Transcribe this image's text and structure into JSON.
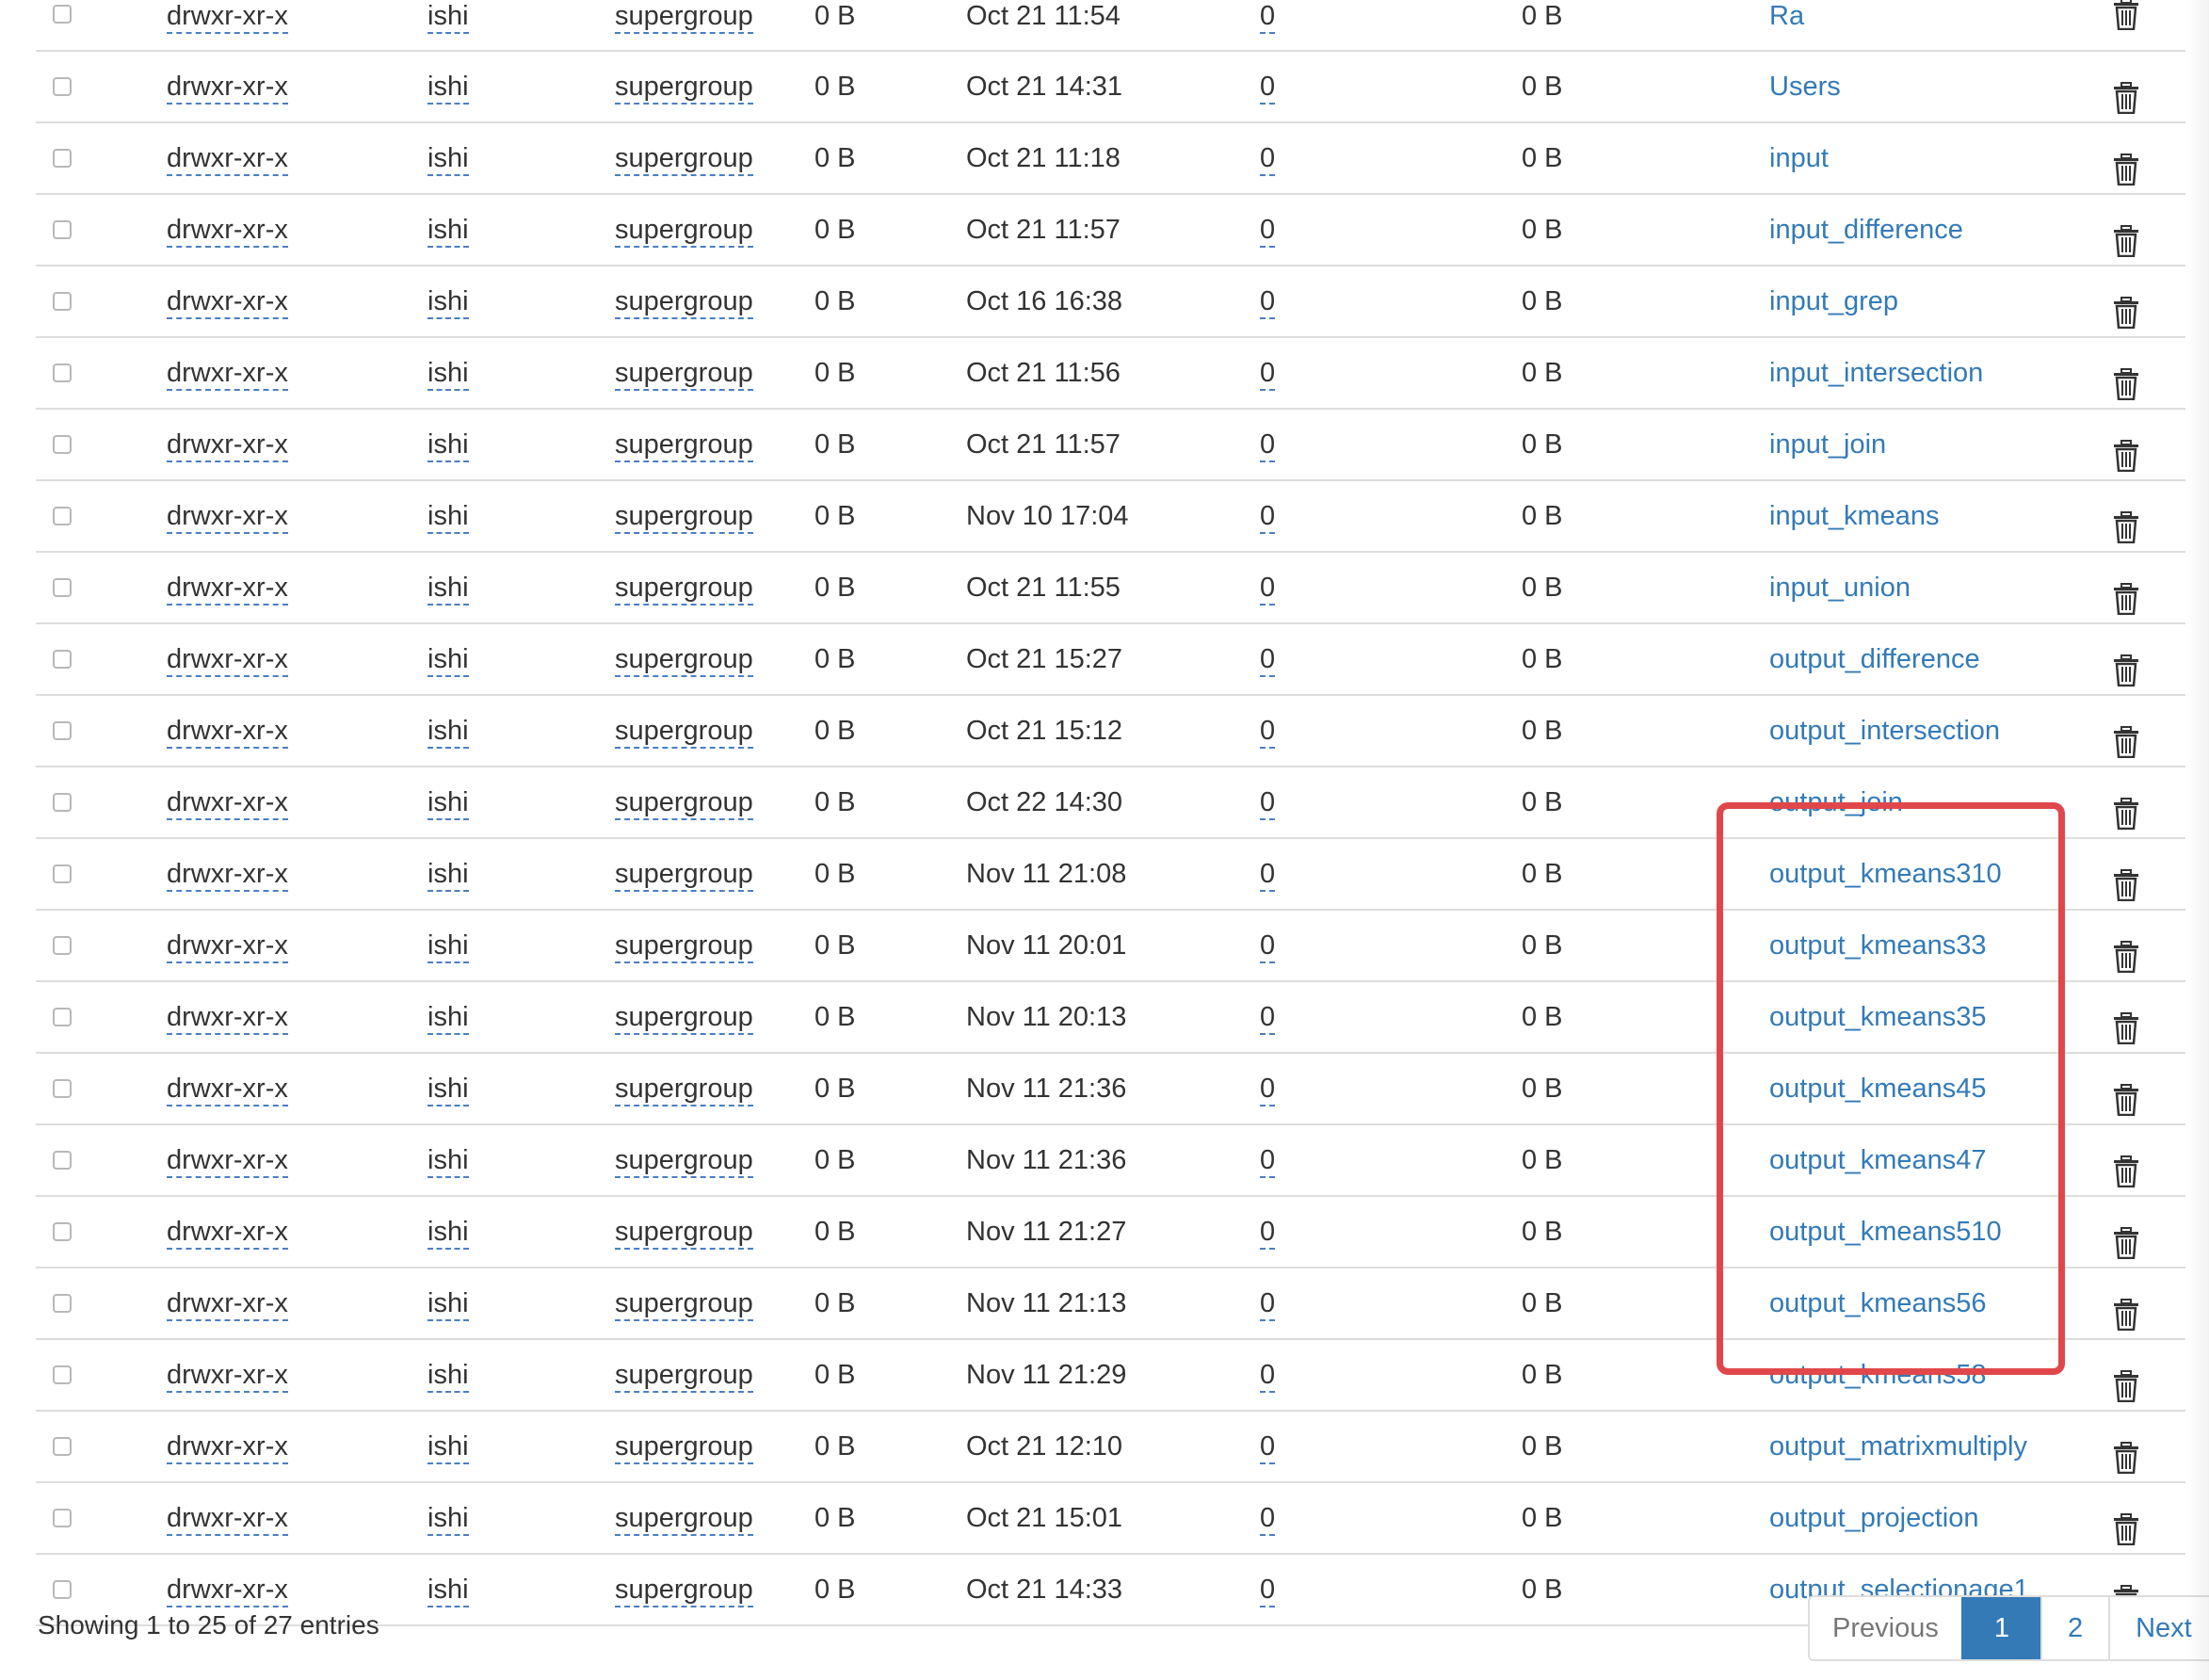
{
  "colors": {
    "link": "#337ab7",
    "highlight": "#e0474b",
    "active_page": "#337ab7"
  },
  "table": {
    "rows": [
      {
        "perm": "drwxr-xr-x",
        "owner": "ishi",
        "group": "supergroup",
        "size": "0 B",
        "modified": "Oct 21 11:54",
        "replication": "0",
        "block_size": "0 B",
        "name": "Ra"
      },
      {
        "perm": "drwxr-xr-x",
        "owner": "ishi",
        "group": "supergroup",
        "size": "0 B",
        "modified": "Oct 21 14:31",
        "replication": "0",
        "block_size": "0 B",
        "name": "Users"
      },
      {
        "perm": "drwxr-xr-x",
        "owner": "ishi",
        "group": "supergroup",
        "size": "0 B",
        "modified": "Oct 21 11:18",
        "replication": "0",
        "block_size": "0 B",
        "name": "input"
      },
      {
        "perm": "drwxr-xr-x",
        "owner": "ishi",
        "group": "supergroup",
        "size": "0 B",
        "modified": "Oct 21 11:57",
        "replication": "0",
        "block_size": "0 B",
        "name": "input_difference"
      },
      {
        "perm": "drwxr-xr-x",
        "owner": "ishi",
        "group": "supergroup",
        "size": "0 B",
        "modified": "Oct 16 16:38",
        "replication": "0",
        "block_size": "0 B",
        "name": "input_grep"
      },
      {
        "perm": "drwxr-xr-x",
        "owner": "ishi",
        "group": "supergroup",
        "size": "0 B",
        "modified": "Oct 21 11:56",
        "replication": "0",
        "block_size": "0 B",
        "name": "input_intersection"
      },
      {
        "perm": "drwxr-xr-x",
        "owner": "ishi",
        "group": "supergroup",
        "size": "0 B",
        "modified": "Oct 21 11:57",
        "replication": "0",
        "block_size": "0 B",
        "name": "input_join"
      },
      {
        "perm": "drwxr-xr-x",
        "owner": "ishi",
        "group": "supergroup",
        "size": "0 B",
        "modified": "Nov 10 17:04",
        "replication": "0",
        "block_size": "0 B",
        "name": "input_kmeans"
      },
      {
        "perm": "drwxr-xr-x",
        "owner": "ishi",
        "group": "supergroup",
        "size": "0 B",
        "modified": "Oct 21 11:55",
        "replication": "0",
        "block_size": "0 B",
        "name": "input_union"
      },
      {
        "perm": "drwxr-xr-x",
        "owner": "ishi",
        "group": "supergroup",
        "size": "0 B",
        "modified": "Oct 21 15:27",
        "replication": "0",
        "block_size": "0 B",
        "name": "output_difference"
      },
      {
        "perm": "drwxr-xr-x",
        "owner": "ishi",
        "group": "supergroup",
        "size": "0 B",
        "modified": "Oct 21 15:12",
        "replication": "0",
        "block_size": "0 B",
        "name": "output_intersection"
      },
      {
        "perm": "drwxr-xr-x",
        "owner": "ishi",
        "group": "supergroup",
        "size": "0 B",
        "modified": "Oct 22 14:30",
        "replication": "0",
        "block_size": "0 B",
        "name": "output_join"
      },
      {
        "perm": "drwxr-xr-x",
        "owner": "ishi",
        "group": "supergroup",
        "size": "0 B",
        "modified": "Nov 11 21:08",
        "replication": "0",
        "block_size": "0 B",
        "name": "output_kmeans310"
      },
      {
        "perm": "drwxr-xr-x",
        "owner": "ishi",
        "group": "supergroup",
        "size": "0 B",
        "modified": "Nov 11 20:01",
        "replication": "0",
        "block_size": "0 B",
        "name": "output_kmeans33"
      },
      {
        "perm": "drwxr-xr-x",
        "owner": "ishi",
        "group": "supergroup",
        "size": "0 B",
        "modified": "Nov 11 20:13",
        "replication": "0",
        "block_size": "0 B",
        "name": "output_kmeans35"
      },
      {
        "perm": "drwxr-xr-x",
        "owner": "ishi",
        "group": "supergroup",
        "size": "0 B",
        "modified": "Nov 11 21:36",
        "replication": "0",
        "block_size": "0 B",
        "name": "output_kmeans45"
      },
      {
        "perm": "drwxr-xr-x",
        "owner": "ishi",
        "group": "supergroup",
        "size": "0 B",
        "modified": "Nov 11 21:36",
        "replication": "0",
        "block_size": "0 B",
        "name": "output_kmeans47"
      },
      {
        "perm": "drwxr-xr-x",
        "owner": "ishi",
        "group": "supergroup",
        "size": "0 B",
        "modified": "Nov 11 21:27",
        "replication": "0",
        "block_size": "0 B",
        "name": "output_kmeans510"
      },
      {
        "perm": "drwxr-xr-x",
        "owner": "ishi",
        "group": "supergroup",
        "size": "0 B",
        "modified": "Nov 11 21:13",
        "replication": "0",
        "block_size": "0 B",
        "name": "output_kmeans56"
      },
      {
        "perm": "drwxr-xr-x",
        "owner": "ishi",
        "group": "supergroup",
        "size": "0 B",
        "modified": "Nov 11 21:29",
        "replication": "0",
        "block_size": "0 B",
        "name": "output_kmeans58"
      },
      {
        "perm": "drwxr-xr-x",
        "owner": "ishi",
        "group": "supergroup",
        "size": "0 B",
        "modified": "Oct 21 12:10",
        "replication": "0",
        "block_size": "0 B",
        "name": "output_matrixmultiply"
      },
      {
        "perm": "drwxr-xr-x",
        "owner": "ishi",
        "group": "supergroup",
        "size": "0 B",
        "modified": "Oct 21 15:01",
        "replication": "0",
        "block_size": "0 B",
        "name": "output_projection"
      },
      {
        "perm": "drwxr-xr-x",
        "owner": "ishi",
        "group": "supergroup",
        "size": "0 B",
        "modified": "Oct 21 14:33",
        "replication": "0",
        "block_size": "0 B",
        "name": "output_selectionage1"
      }
    ],
    "row_icon": "trash-icon"
  },
  "footer": {
    "info": "Showing 1 to 25 of 27 entries",
    "pagination": {
      "previous": "Previous",
      "pages": [
        "1",
        "2"
      ],
      "current": "1",
      "next": "Next"
    }
  }
}
